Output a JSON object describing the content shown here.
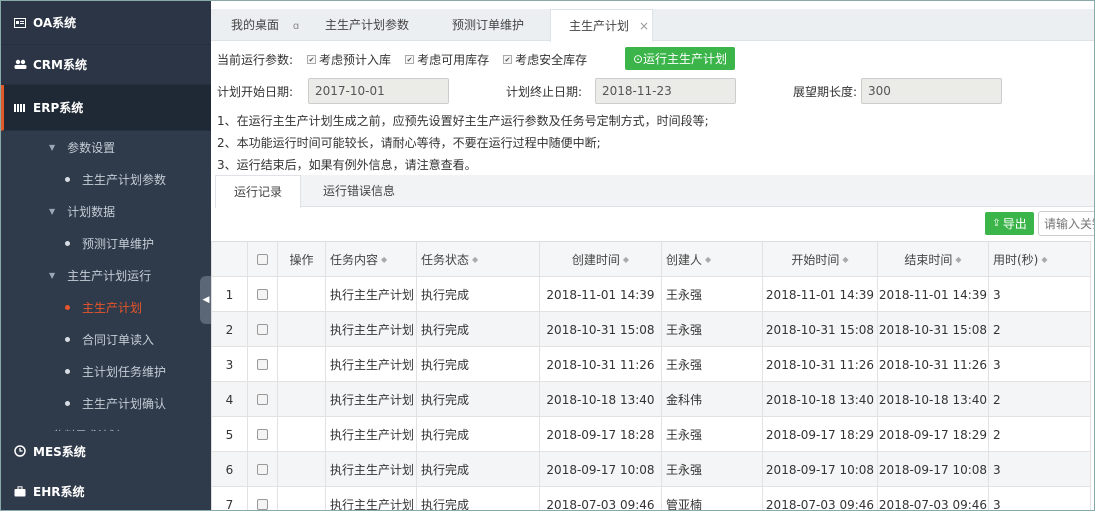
{
  "sidebar": {
    "items": [
      {
        "label": "OA系统",
        "icon": "id-card-icon"
      },
      {
        "label": "CRM系统",
        "icon": "users-icon"
      },
      {
        "label": "ERP系统",
        "icon": "bars-icon"
      }
    ],
    "erp_children": [
      {
        "type": "group",
        "label": "参数设置"
      },
      {
        "type": "leaf",
        "label": "主生产计划参数"
      },
      {
        "type": "group",
        "label": "计划数据"
      },
      {
        "type": "leaf",
        "label": "预测订单维护"
      },
      {
        "type": "group",
        "label": "主生产计划运行"
      },
      {
        "type": "leaf",
        "label": "主生产计划",
        "active": true
      },
      {
        "type": "leaf",
        "label": "合同订单读入"
      },
      {
        "type": "leaf",
        "label": "主计划任务维护"
      },
      {
        "type": "leaf",
        "label": "主生产计划确认"
      },
      {
        "type": "group",
        "label": "物料需求计划"
      }
    ],
    "bottom_items": [
      {
        "label": "MES系统",
        "icon": "clock-icon"
      },
      {
        "label": "EHR系统",
        "icon": "briefcase-icon"
      }
    ]
  },
  "tabs": [
    {
      "label": "我的桌面",
      "extra": "ɑ"
    },
    {
      "label": "主生产计划参数"
    },
    {
      "label": "预测订单维护"
    },
    {
      "label": "主生产计划",
      "active": true,
      "close": "×"
    }
  ],
  "params": {
    "label": "当前运行参数:",
    "options": [
      "考虑预计入库",
      "考虑可用库存",
      "考虑安全库存"
    ],
    "check_mark": "✔",
    "run_button": "⊙运行主生产计划"
  },
  "dates": {
    "start_label": "计划开始日期:",
    "start_value": "2017-10-01",
    "end_label": "计划终止日期:",
    "end_value": "2018-11-23",
    "horizon_label": "展望期长度:",
    "horizon_value": "300"
  },
  "notes": [
    "1、在运行主生产计划生成之前，应预先设置好主生产运行参数及任务号定制方式，时间段等;",
    "2、本功能运行时间可能较长，请耐心等待，不要在运行过程中随便中断;",
    "3、运行结束后，如果有例外信息，请注意查看。"
  ],
  "sub_tabs": [
    "运行记录",
    "运行错误信息"
  ],
  "toolbar": {
    "export_label": "导出",
    "export_icon": "export-icon",
    "search_placeholder": "请输入关键"
  },
  "table": {
    "headers": [
      "操作",
      "任务内容",
      "任务状态",
      "创建时间",
      "创建人",
      "开始时间",
      "结束时间",
      "用时(秒)"
    ],
    "rows": [
      {
        "no": "1",
        "content": "执行主生产计划",
        "status": "执行完成",
        "created": "2018-11-01 14:39",
        "creator": "王永强",
        "start": "2018-11-01 14:39",
        "end": "2018-11-01 14:39",
        "secs": "3"
      },
      {
        "no": "2",
        "content": "执行主生产计划",
        "status": "执行完成",
        "created": "2018-10-31 15:08",
        "creator": "王永强",
        "start": "2018-10-31 15:08",
        "end": "2018-10-31 15:08",
        "secs": "2"
      },
      {
        "no": "3",
        "content": "执行主生产计划",
        "status": "执行完成",
        "created": "2018-10-31 11:26",
        "creator": "王永强",
        "start": "2018-10-31 11:26",
        "end": "2018-10-31 11:26",
        "secs": "3"
      },
      {
        "no": "4",
        "content": "执行主生产计划",
        "status": "执行完成",
        "created": "2018-10-18 13:40",
        "creator": "金科伟",
        "start": "2018-10-18 13:40",
        "end": "2018-10-18 13:40",
        "secs": "2"
      },
      {
        "no": "5",
        "content": "执行主生产计划",
        "status": "执行完成",
        "created": "2018-09-17 18:28",
        "creator": "王永强",
        "start": "2018-09-17 18:29",
        "end": "2018-09-17 18:29",
        "secs": "2"
      },
      {
        "no": "6",
        "content": "执行主生产计划",
        "status": "执行完成",
        "created": "2018-09-17 10:08",
        "creator": "王永强",
        "start": "2018-09-17 10:08",
        "end": "2018-09-17 10:08",
        "secs": "3"
      },
      {
        "no": "7",
        "content": "执行主生产计划",
        "status": "执行完成",
        "created": "2018-07-03 09:46",
        "creator": "管亚楠",
        "start": "2018-07-03 09:46",
        "end": "2018-07-03 09:46",
        "secs": "3"
      }
    ]
  },
  "colors": {
    "accent": "#e8552a",
    "green": "#3bb54a",
    "sidebar_bg": "#2f3a4a"
  }
}
